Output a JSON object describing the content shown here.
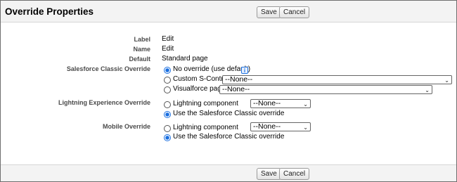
{
  "header": {
    "title": "Override Properties",
    "save_label": "Save",
    "cancel_label": "Cancel"
  },
  "footer": {
    "save_label": "Save",
    "cancel_label": "Cancel"
  },
  "fields": {
    "label": {
      "label": "Label",
      "value": "Edit"
    },
    "name": {
      "label": "Name",
      "value": "Edit"
    },
    "default": {
      "label": "Default",
      "value": "Standard page"
    }
  },
  "classic_override": {
    "label": "Salesforce Classic Override",
    "options": {
      "no_override": "No override (use default)",
      "custom_s_control": "Custom S-Control",
      "visualforce_page": "Visualforce page"
    },
    "selected": "no_override",
    "s_control_select": "--None--",
    "visualforce_select": "--None--",
    "info_icon": "info-icon"
  },
  "lightning_override": {
    "label": "Lightning Experience Override",
    "options": {
      "lightning_component": "Lightning component",
      "use_classic": "Use the Salesforce Classic override"
    },
    "selected": "use_classic",
    "component_select": "--None--"
  },
  "mobile_override": {
    "label": "Mobile Override",
    "options": {
      "lightning_component": "Lightning component",
      "use_classic": "Use the Salesforce Classic override"
    },
    "selected": "use_classic",
    "component_select": "--None--"
  },
  "colors": {
    "accent": "#1a6fe0",
    "bar_bg": "#f3f3f3",
    "label_text": "#4a4a4a"
  }
}
